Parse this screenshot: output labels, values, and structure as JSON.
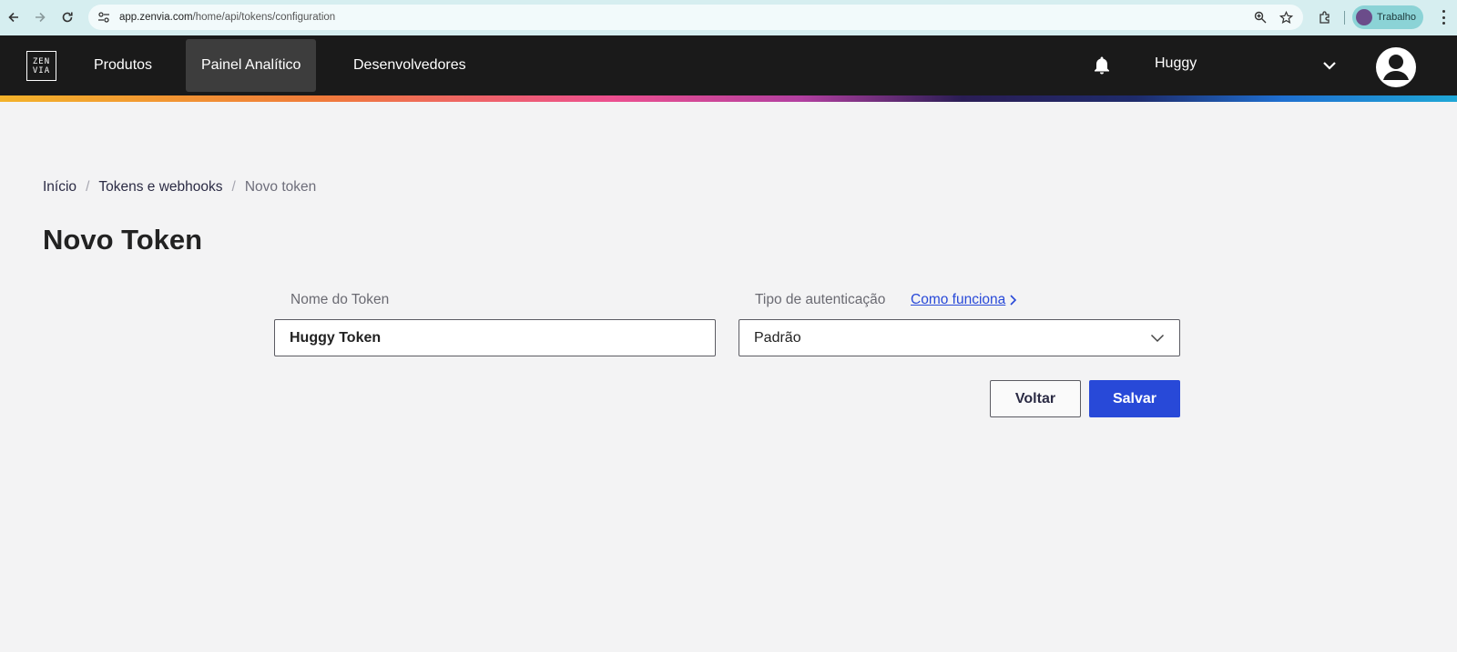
{
  "browser": {
    "url_host": "app.zenvia.com",
    "url_path": "/home/api/tokens/configuration",
    "profile_label": "Trabalho",
    "icons": [
      "back-arrow-icon",
      "forward-arrow-icon",
      "reload-icon",
      "site-settings-icon",
      "zoom-icon",
      "star-icon",
      "extensions-icon",
      "kebab-menu-icon"
    ]
  },
  "header": {
    "logo_top": "ZEN",
    "logo_bottom": "VIA",
    "nav": [
      {
        "label": "Produtos"
      },
      {
        "label": "Painel Analítico"
      },
      {
        "label": "Desenvolvedores"
      }
    ],
    "user_name": "Huggy",
    "icons": [
      "bell-icon",
      "chevron-down-icon",
      "user-avatar-icon"
    ]
  },
  "breadcrumb": {
    "items": [
      "Início",
      "Tokens e webhooks",
      "Novo token"
    ],
    "separator": "/"
  },
  "page": {
    "title": "Novo Token"
  },
  "form": {
    "token_name_label": "Nome do Token",
    "token_name_value": "Huggy Token",
    "auth_type_label": "Tipo de autenticação",
    "help_link": "Como funciona",
    "auth_type_value": "Padrão",
    "back_label": "Voltar",
    "save_label": "Salvar"
  },
  "colors": {
    "primary": "#2849d8",
    "header_bg": "#1a1a1a",
    "page_bg": "#f3f3f4"
  }
}
